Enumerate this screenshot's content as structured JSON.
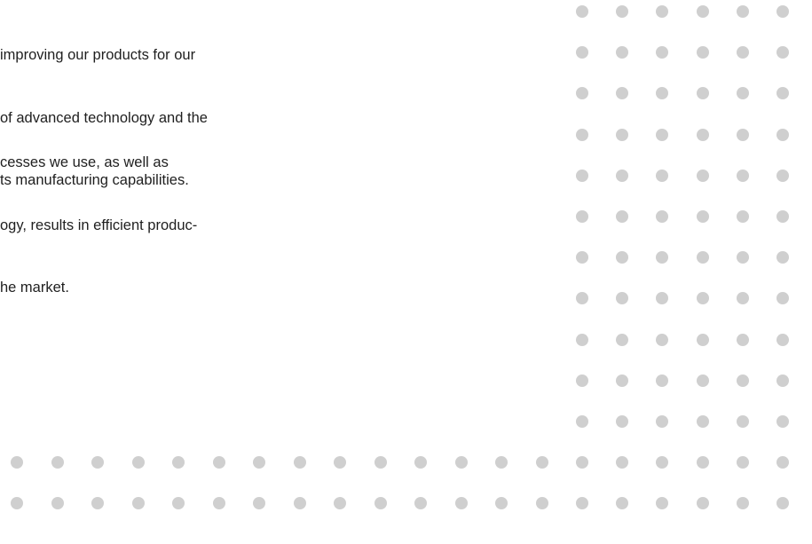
{
  "paragraphs": [
    {
      "lines": [
        "improving our products for our",
        "of advanced technology and the",
        "ts manufacturing capabilities."
      ]
    },
    {
      "lines": [
        "cesses we use, as well as",
        "ogy, results in efficient produc-",
        "he market."
      ]
    }
  ],
  "colors": {
    "text": "#1f1f1f",
    "dot": "#cfcfcf",
    "background": "#ffffff"
  }
}
